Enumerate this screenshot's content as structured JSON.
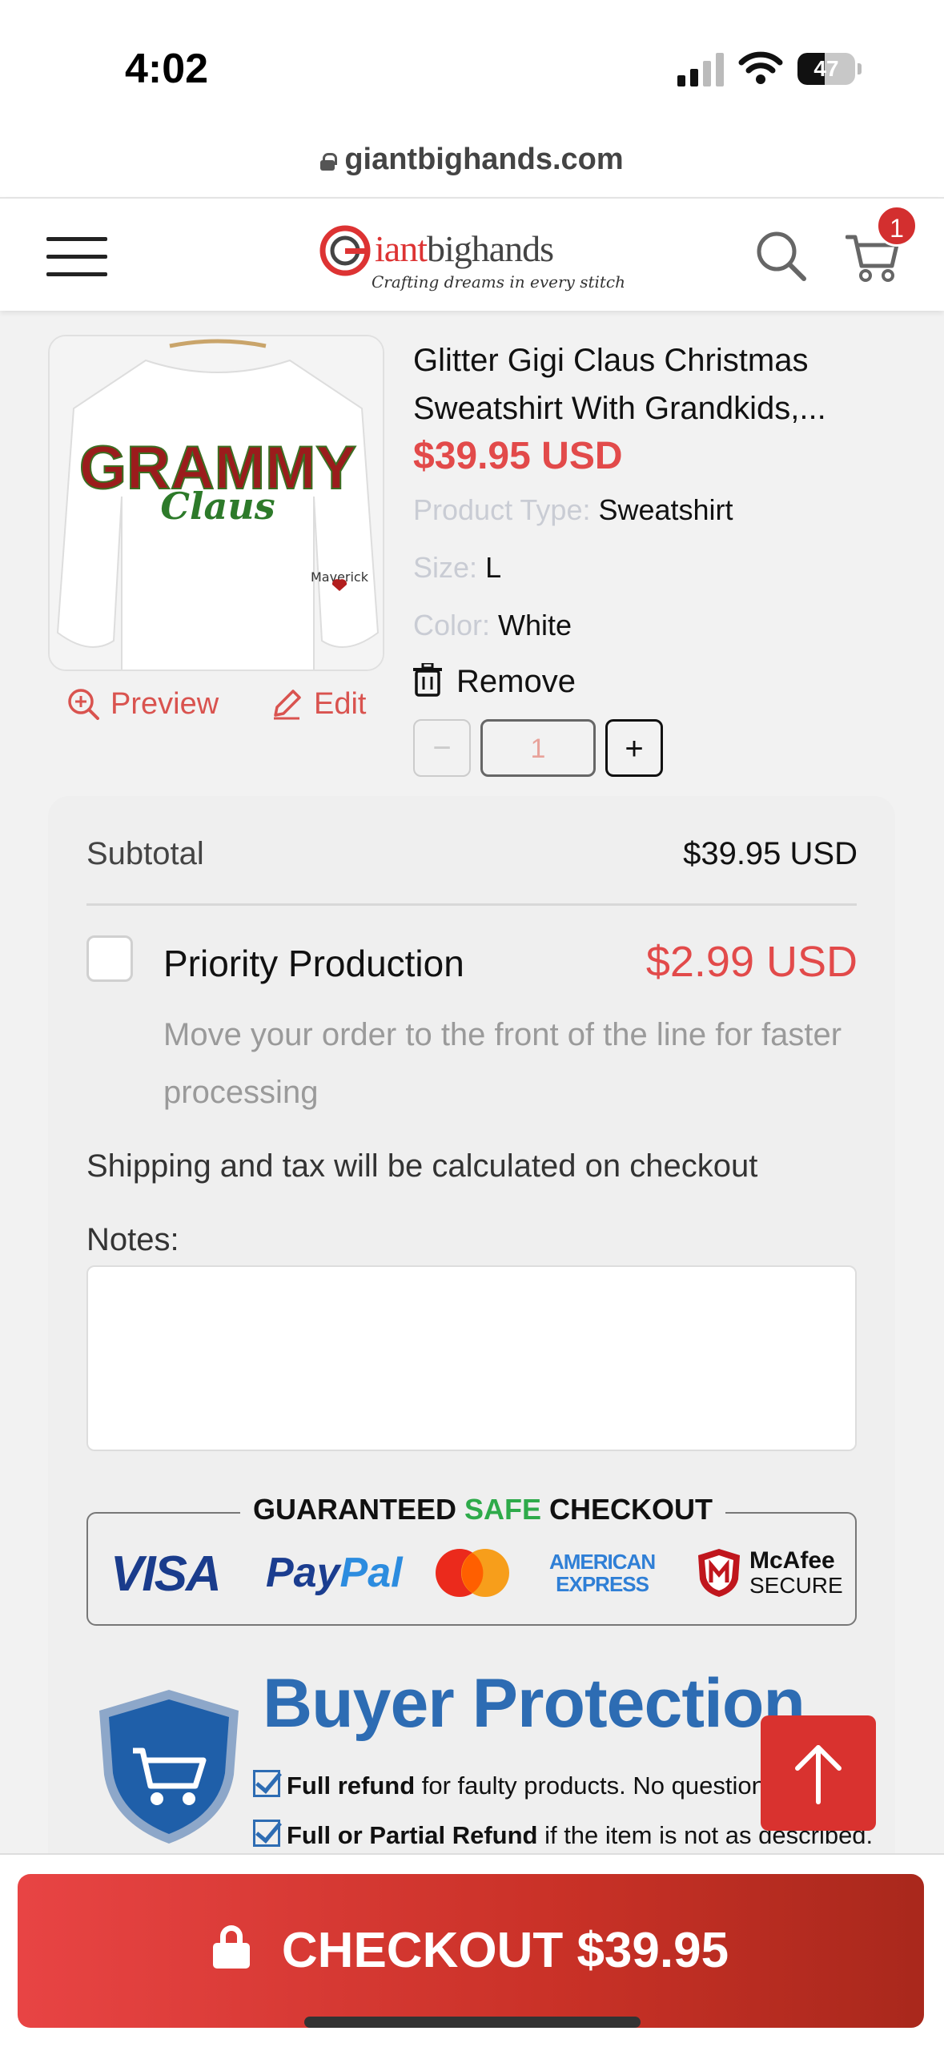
{
  "status_bar": {
    "time": "4:02",
    "battery": "47",
    "battery_level": 0.47
  },
  "browser": {
    "url": "giantbighands.com"
  },
  "header": {
    "logo_text_red": "iant",
    "logo_text_gray": "bighands",
    "logo_tagline": "Crafting dreams in every stitch",
    "cart_count": "1"
  },
  "product": {
    "title": "Glitter Gigi Claus Christmas Sweatshirt With Grandkids,...",
    "price": "$39.95 USD",
    "image_text_main": "GRAMMY",
    "image_text_script": "Claus",
    "image_sleeve_text": "Maverick",
    "attributes": [
      {
        "key": "Product Type:",
        "value": "Sweatshirt"
      },
      {
        "key": "Size:",
        "value": "L"
      },
      {
        "key": "Color:",
        "value": "White"
      }
    ],
    "remove_label": "Remove",
    "preview_label": "Preview",
    "edit_label": "Edit",
    "quantity": "1",
    "minus_label": "−",
    "plus_label": "+"
  },
  "summary": {
    "subtotal_label": "Subtotal",
    "subtotal_value": "$39.95 USD",
    "priority_label": "Priority Production",
    "priority_price": "$2.99 USD",
    "priority_desc": "Move your order to the front of the line for faster processing",
    "shipping_note": "Shipping and tax will be calculated on checkout",
    "notes_label": "Notes:",
    "notes_value": ""
  },
  "safe_checkout": {
    "title_before": "GUARANTEED ",
    "title_green": "SAFE",
    "title_after": " CHECKOUT",
    "visa": "VISA",
    "paypal_dark": "Pay",
    "paypal_light": "Pal",
    "amex_line1": "AMERICAN",
    "amex_line2": "EXPRESS",
    "mcafee_line1": "McAfee",
    "mcafee_line2": "SECURE"
  },
  "buyer_protection": {
    "title": "Buyer Protection",
    "line1_bold": "Full refund",
    "line1_rest": " for faulty products. No question",
    "line2_bold": "Full or Partial Refund",
    "line2_rest": " if the item is not as described."
  },
  "checkout": {
    "label": "CHECKOUT $39.95"
  },
  "colors": {
    "accent_red": "#e24a4a",
    "brand_blue": "#2d6cb3",
    "safe_green": "#2eaa4a"
  }
}
